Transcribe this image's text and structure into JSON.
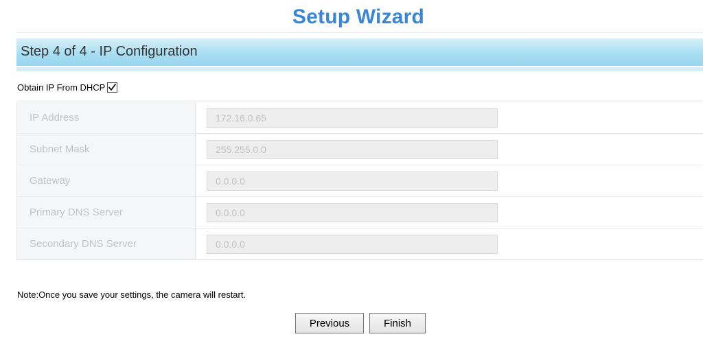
{
  "header": {
    "title": "Setup Wizard"
  },
  "step": {
    "title": "Step 4 of 4 - IP Configuration"
  },
  "dhcp": {
    "label": "Obtain IP From DHCP",
    "checked": true
  },
  "ip_fields": [
    {
      "label": "IP Address",
      "value": "172.16.0.65"
    },
    {
      "label": "Subnet Mask",
      "value": "255.255.0.0"
    },
    {
      "label": "Gateway",
      "value": "0.0.0.0"
    },
    {
      "label": "Primary DNS Server",
      "value": "0.0.0.0"
    },
    {
      "label": "Secondary DNS Server",
      "value": "0.0.0.0"
    }
  ],
  "note": "Note:Once you save your settings, the camera will restart.",
  "buttons": {
    "previous": "Previous",
    "finish": "Finish"
  },
  "colors": {
    "title": "#3a86d6",
    "step_bar": "#a9def2"
  }
}
